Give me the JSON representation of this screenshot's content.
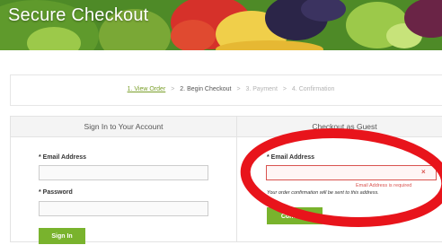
{
  "banner": {
    "title": "Secure Checkout"
  },
  "steps": {
    "step1": "1. View Order",
    "sep": ">",
    "step2": "2. Begin Checkout",
    "step3": "3. Payment",
    "step4": "4. Confirmation"
  },
  "sign_in": {
    "header": "Sign In to Your Account",
    "email_label": "* Email Address",
    "email_value": "",
    "password_label": "* Password",
    "password_value": "",
    "button": "Sign In"
  },
  "guest": {
    "header": "Checkout as Guest",
    "email_label": "* Email Address",
    "email_value": "",
    "error_icon": "×",
    "error_message": "Email Address is required",
    "note": "Your order confirmation will be sent to this address.",
    "button": "Continue"
  },
  "colors": {
    "accent_green": "#79b32d",
    "error_red": "#d9534f",
    "annotation_red": "#e8141b"
  },
  "icons": {
    "error": "close-x-icon"
  }
}
